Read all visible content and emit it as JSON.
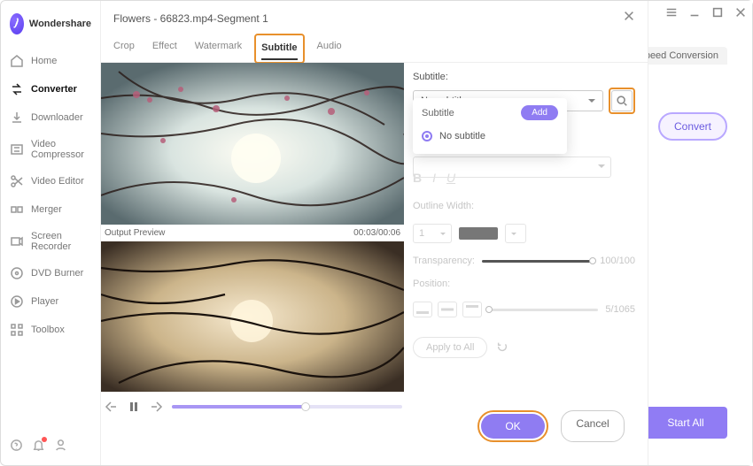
{
  "brand": "Wondershare",
  "sidebar": {
    "items": [
      {
        "label": "Home"
      },
      {
        "label": "Converter"
      },
      {
        "label": "Downloader"
      },
      {
        "label": "Video Compressor"
      },
      {
        "label": "Video Editor"
      },
      {
        "label": "Merger"
      },
      {
        "label": "Screen Recorder"
      },
      {
        "label": "DVD Burner"
      },
      {
        "label": "Player"
      },
      {
        "label": "Toolbox"
      }
    ]
  },
  "main": {
    "speed_tab": "Speed Conversion",
    "convert_btn": "Convert",
    "start_all": "Start All"
  },
  "dialog": {
    "title": "Flowers - 66823.mp4-Segment 1",
    "tabs": [
      "Crop",
      "Effect",
      "Watermark",
      "Subtitle",
      "Audio"
    ],
    "active_tab": "Subtitle",
    "preview_label": "Output Preview",
    "timecode": "00:03/00:06",
    "subtitle": {
      "label": "Subtitle:",
      "selected": "No subtitle",
      "popup_title": "Subtitle",
      "add_btn": "Add",
      "option_none": "No subtitle"
    },
    "outline_label": "Outline Width:",
    "outline_value": "1",
    "transparency_label": "Transparency:",
    "transparency_value": "100/100",
    "position_label": "Position:",
    "position_value": "5/1065",
    "apply_all": "Apply to All",
    "ok": "OK",
    "cancel": "Cancel"
  }
}
